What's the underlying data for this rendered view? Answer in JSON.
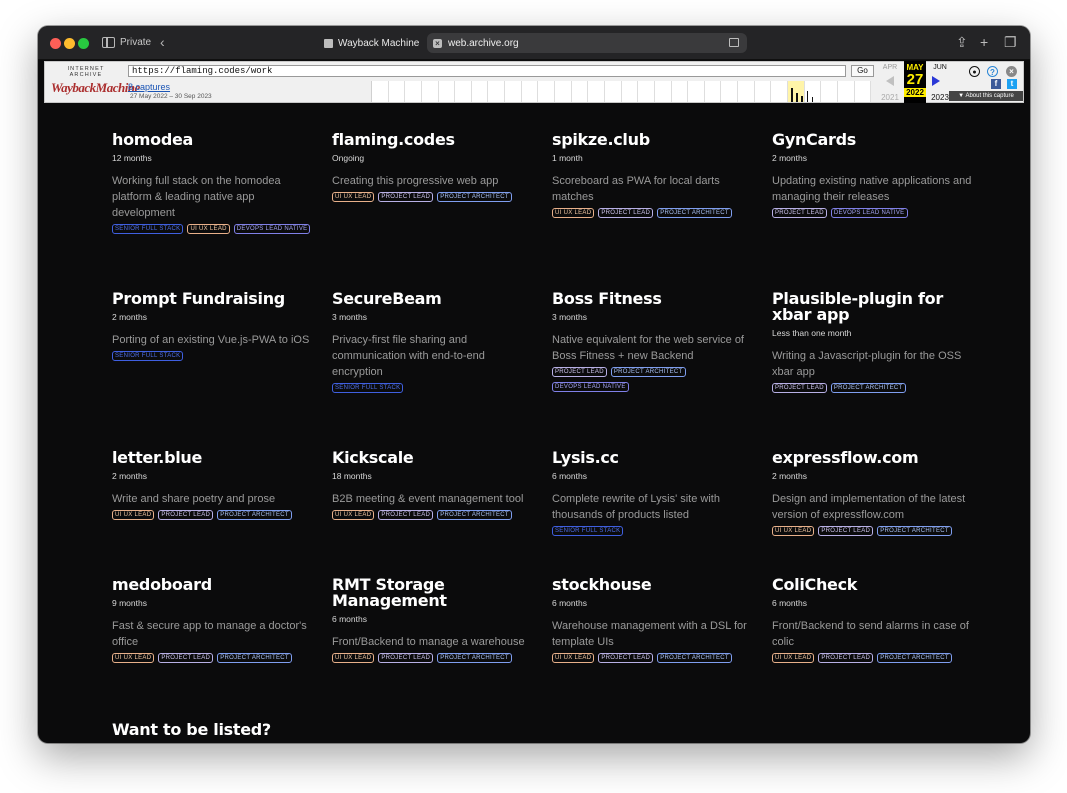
{
  "browser": {
    "private_label": "Private",
    "tab1_title": "Wayback Machine",
    "tab2_title": "web.archive.org"
  },
  "wayback": {
    "logo_top": "INTERNET ARCHIVE",
    "logo_main": "WaybackMachine",
    "url": "https://flaming.codes/work",
    "go_label": "Go",
    "captures_link": "8 captures",
    "capture_range": "27 May 2022 – 30 Sep 2023",
    "prev_month": "APR",
    "prev_year": "2021",
    "cur_month": "MAY",
    "cur_day": "27",
    "cur_year": "2022",
    "next_month": "JUN",
    "next_year": "2023",
    "about_label": "▼ About this capture"
  },
  "projects": [
    {
      "title": "homodea",
      "duration": "12 months",
      "description": "Working full stack on the homodea platform & leading native app development",
      "tags": [
        {
          "label": "SENIOR FULL STACK",
          "kind": "senior"
        },
        {
          "label": "UI UX LEAD",
          "kind": "uiux"
        },
        {
          "label": "DEVOPS LEAD NATIVE",
          "kind": "devops"
        }
      ]
    },
    {
      "title": "flaming.codes",
      "duration": "Ongoing",
      "description": " Creating this progressive web app",
      "tags": [
        {
          "label": "UI UX LEAD",
          "kind": "uiux"
        },
        {
          "label": "PROJECT LEAD",
          "kind": "lead"
        },
        {
          "label": "PROJECT ARCHITECT",
          "kind": "arch"
        }
      ]
    },
    {
      "title": "spikze.club",
      "duration": "1 month",
      "description": "Scoreboard as PWA for local darts matches",
      "tags": [
        {
          "label": "UI UX LEAD",
          "kind": "uiux"
        },
        {
          "label": "PROJECT LEAD",
          "kind": "lead"
        },
        {
          "label": "PROJECT ARCHITECT",
          "kind": "arch"
        }
      ]
    },
    {
      "title": "GynCards",
      "duration": "2 months",
      "description": "Updating existing native applications and managing their releases",
      "tags": [
        {
          "label": "PROJECT LEAD",
          "kind": "lead"
        },
        {
          "label": "DEVOPS LEAD NATIVE",
          "kind": "devops"
        }
      ]
    },
    {
      "title": "Prompt Fundraising",
      "duration": "2 months",
      "description": "Porting of an existing Vue.js-PWA to iOS",
      "tags": [
        {
          "label": "SENIOR FULL STACK",
          "kind": "senior"
        }
      ]
    },
    {
      "title": "SecureBeam",
      "duration": "3 months",
      "description": "Privacy-first file sharing and communication with end-to-end encryption",
      "tags": [
        {
          "label": "SENIOR FULL STACK",
          "kind": "senior"
        }
      ]
    },
    {
      "title": "Boss Fitness",
      "duration": "3 months",
      "description": "Native equivalent for the web service of Boss Fitness + new Backend",
      "tags": [
        {
          "label": "PROJECT LEAD",
          "kind": "lead"
        },
        {
          "label": "PROJECT ARCHITECT",
          "kind": "arch"
        },
        {
          "label": "DEVOPS LEAD NATIVE",
          "kind": "devops"
        }
      ]
    },
    {
      "title": "Plausible-plugin for xbar app",
      "duration": "Less than one month",
      "description": "Writing a Javascript-plugin for the OSS xbar app",
      "tags": [
        {
          "label": "PROJECT LEAD",
          "kind": "lead"
        },
        {
          "label": "PROJECT ARCHITECT",
          "kind": "arch"
        }
      ]
    },
    {
      "title": "letter.blue",
      "duration": "2 months",
      "description": " Write and share poetry and prose",
      "tags": [
        {
          "label": "UI UX LEAD",
          "kind": "uiux"
        },
        {
          "label": "PROJECT LEAD",
          "kind": "lead"
        },
        {
          "label": "PROJECT ARCHITECT",
          "kind": "arch"
        }
      ]
    },
    {
      "title": "Kickscale",
      "duration": "18 months",
      "description": "B2B meeting & event management tool",
      "tags": [
        {
          "label": "UI UX LEAD",
          "kind": "uiux"
        },
        {
          "label": "PROJECT LEAD",
          "kind": "lead"
        },
        {
          "label": "PROJECT ARCHITECT",
          "kind": "arch"
        }
      ]
    },
    {
      "title": "Lysis.cc",
      "duration": "6 months",
      "description": "Complete rewrite of Lysis' site with thousands of products listed",
      "tags": [
        {
          "label": "SENIOR FULL STACK",
          "kind": "senior"
        }
      ]
    },
    {
      "title": "expressflow.com",
      "duration": "2 months",
      "description": "Design and implementation of the latest version of expressflow.com",
      "tags": [
        {
          "label": "UI UX LEAD",
          "kind": "uiux"
        },
        {
          "label": "PROJECT LEAD",
          "kind": "lead"
        },
        {
          "label": "PROJECT ARCHITECT",
          "kind": "arch"
        }
      ]
    },
    {
      "title": "medoboard",
      "duration": "9 months",
      "description": "Fast & secure app to manage a doctor's office",
      "tags": [
        {
          "label": "UI UX LEAD",
          "kind": "uiux"
        },
        {
          "label": "PROJECT LEAD",
          "kind": "lead"
        },
        {
          "label": "PROJECT ARCHITECT",
          "kind": "arch"
        }
      ]
    },
    {
      "title": "RMT Storage Management",
      "duration": "6 months",
      "description": "Front/Backend to manage a warehouse",
      "tags": [
        {
          "label": "UI UX LEAD",
          "kind": "uiux"
        },
        {
          "label": "PROJECT LEAD",
          "kind": "lead"
        },
        {
          "label": "PROJECT ARCHITECT",
          "kind": "arch"
        }
      ]
    },
    {
      "title": "stockhouse",
      "duration": "6 months",
      "description": "Warehouse management with a DSL for template UIs",
      "tags": [
        {
          "label": "UI UX LEAD",
          "kind": "uiux"
        },
        {
          "label": "PROJECT LEAD",
          "kind": "lead"
        },
        {
          "label": "PROJECT ARCHITECT",
          "kind": "arch"
        }
      ]
    },
    {
      "title": "ColiCheck",
      "duration": "6 months",
      "description": "Front/Backend to send alarms in case of colic",
      "tags": [
        {
          "label": "UI UX LEAD",
          "kind": "uiux"
        },
        {
          "label": "PROJECT LEAD",
          "kind": "lead"
        },
        {
          "label": "PROJECT ARCHITECT",
          "kind": "arch"
        }
      ]
    }
  ],
  "footer_heading": "Want to be listed?"
}
